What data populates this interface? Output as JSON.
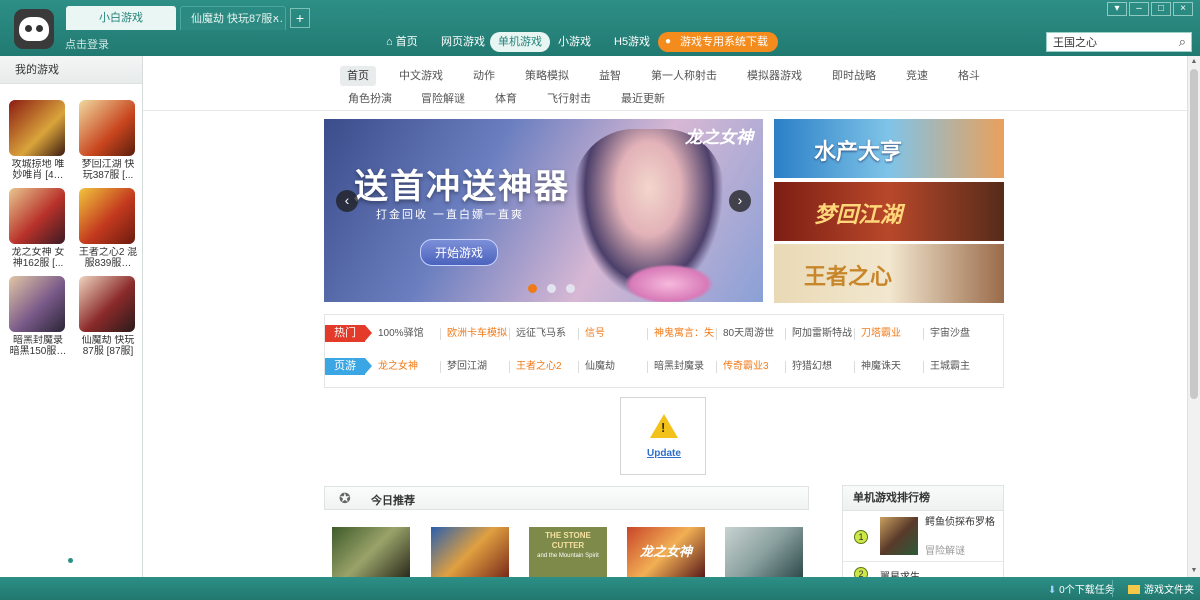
{
  "titlebar": {
    "tabs": [
      {
        "label": "小白游戏"
      },
      {
        "label": "仙魔劫 快玩87服…"
      }
    ],
    "tab_close": "×",
    "tab_add": "+",
    "login": "点击登录",
    "window_controls": [
      "▾",
      "–",
      "□",
      "×"
    ]
  },
  "nav": {
    "home": "首页",
    "web": "网页游戏",
    "single": "单机游戏",
    "mini": "小游戏",
    "h5": "H5游戏",
    "download": "游戏专用系统下载"
  },
  "search": {
    "value": "王国之心",
    "icon": "search-icon"
  },
  "sidebar": {
    "title": "我的游戏",
    "games": [
      {
        "name": "攻城掠地 唯妙唯肖 [4…"
      },
      {
        "name": "梦回江湖 快玩387服 [..."
      },
      {
        "name": "龙之女神 女神162服 [..."
      },
      {
        "name": "王者之心2 混服839服…"
      },
      {
        "name": "暗黑封魔录 暗黑150服…"
      },
      {
        "name": "仙魔劫 快玩87服 [87服]"
      }
    ]
  },
  "categories": {
    "row1": [
      "首页",
      "中文游戏",
      "动作",
      "策略模拟",
      "益智",
      "第一人称射击",
      "模拟器游戏",
      "即时战略",
      "竞速",
      "格斗"
    ],
    "row2": [
      "角色扮演",
      "冒险解谜",
      "体育",
      "飞行射击",
      "最近更新"
    ]
  },
  "banner": {
    "title": "送首冲送神器",
    "subtitle": "打金回收 一直白嫖一直爽",
    "button": "开始游戏",
    "brand": "龙之女神",
    "prev": "‹",
    "next": "›"
  },
  "side_banners": [
    "水产大亨",
    "梦回江湖",
    "王者之心"
  ],
  "hot": {
    "tag_hot": "热门",
    "tag_web": "页游",
    "row1": [
      "100%驿馆",
      "欧洲卡车模拟",
      "远征飞马系",
      "信号",
      "神鬼寓言：失",
      "80天周游世",
      "阿加雷斯特战",
      "刀塔霸业",
      "宇宙沙盘"
    ],
    "row2": [
      "龙之女神",
      "梦回江湖",
      "王者之心2",
      "仙魔劫",
      "暗黑封魔录",
      "传奇霸业3",
      "狩猎幻想",
      "神魔诛天",
      "王城霸主"
    ]
  },
  "update": {
    "label": "Update"
  },
  "recommend": {
    "title": "今日推荐",
    "thumb3_text": "THE STONE CUTTER",
    "thumb3_sub": "and the Mountain Spirit",
    "thumb4_text": "龙之女神"
  },
  "ranking": {
    "title": "单机游戏排行榜",
    "items": [
      {
        "rank": "1",
        "name": "鳄鱼侦探布罗格",
        "genre": "冒险解谜"
      },
      {
        "rank": "2",
        "name": "翼星求生"
      }
    ]
  },
  "status": {
    "downloads": "0个下载任务",
    "folder": "游戏文件夹"
  },
  "colors": {
    "accent": "#2a8f86",
    "orange": "#f07a18",
    "hot_red": "#e33a2a",
    "web_blue": "#3aa6e3"
  }
}
